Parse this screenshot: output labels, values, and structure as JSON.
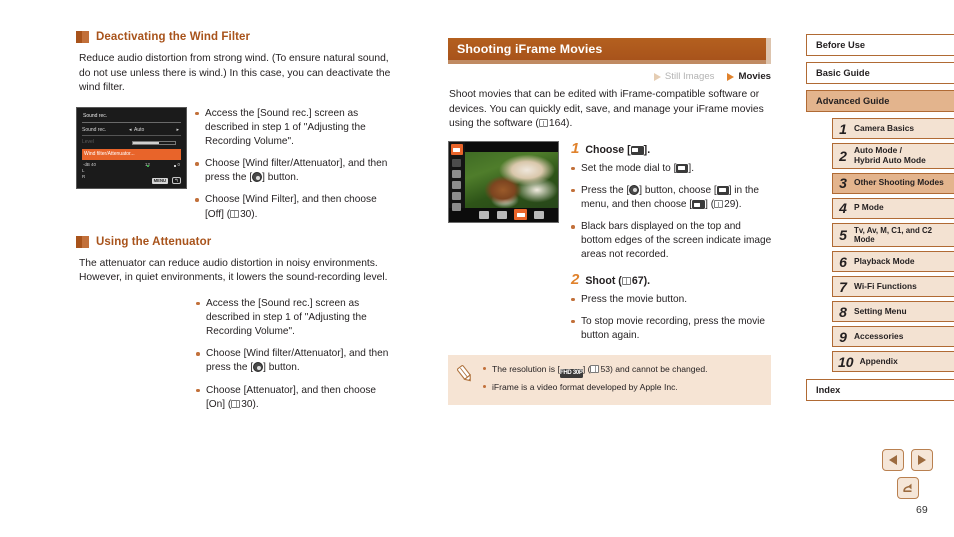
{
  "left_column": {
    "sections": [
      {
        "heading": "Deactivating the Wind Filter",
        "intro": "Reduce audio distortion from strong wind. (To ensure natural sound, do not use unless there is wind.) In this case, you can deactivate the wind filter.",
        "screen": {
          "title": "Sound rec.",
          "row1_label": "Sound rec.",
          "row1_value": "Auto",
          "row2_label": "Level",
          "selected_row": "Wind filter/Attenuator...",
          "scale_left": "-dB 40",
          "scale_mid": "12",
          "scale_right": "0",
          "channel_l": "L",
          "channel_r": "R",
          "menu_button": "MENU"
        },
        "bullets": [
          "Access the [Sound rec.] screen as described in step 1 of \"Adjusting the Recording Volume\".",
          "Choose [Wind filter/Attenuator], and then press the [FUNC] button.",
          "Choose [Wind Filter], and then choose [Off] (30)."
        ],
        "bullet3_parts": {
          "pre": "Choose [Wind Filter], and then choose [Off] (",
          "page_ref": "30",
          "post": ")."
        }
      },
      {
        "heading": "Using the Attenuator",
        "intro": "The attenuator can reduce audio distortion in noisy environments. However, in quiet environments, it lowers the sound-recording level.",
        "bullets": [
          "Access the [Sound rec.] screen as described in step 1 of \"Adjusting the Recording Volume\".",
          "Choose [Wind filter/Attenuator], and then press the [FUNC] button.",
          "Choose [Attenuator], and then choose [On] (30)."
        ],
        "bullet3_parts": {
          "pre": "Choose [Attenuator], and then choose [On] (",
          "page_ref": "30",
          "post": ")."
        }
      }
    ]
  },
  "middle_column": {
    "header_title": "Shooting iFrame Movies",
    "media_tags": [
      {
        "label": "Still Images",
        "active": false
      },
      {
        "label": "Movies",
        "active": true
      }
    ],
    "intro_pre": "Shoot movies that can be edited with iFrame-compatible software or devices. You can quickly edit, save, and manage your iFrame movies using the software (",
    "intro_ref": "164",
    "intro_post": ").",
    "steps": [
      {
        "number": "1",
        "label_pre": "Choose [",
        "label_post": "].",
        "bullets": [
          {
            "pre": "Set the mode dial to [",
            "mid": "",
            "post": "]."
          },
          {
            "pre": "Press the [",
            "mid": "] button, choose [",
            "post": "] in the menu, and then choose [",
            "ref": "29",
            "tail": ")."
          },
          {
            "plain": "Black bars displayed on the top and bottom edges of the screen indicate image areas not recorded."
          }
        ]
      },
      {
        "number": "2",
        "label_pre": "Shoot (",
        "label_ref": "67",
        "label_post": ").",
        "bullets": [
          {
            "plain": "Press the movie button."
          },
          {
            "plain": "To stop movie recording, press the movie button again."
          }
        ]
      }
    ],
    "note": {
      "items": [
        {
          "pre": "The resolution is [",
          "badge": "FHD 30P",
          "mid": "] (",
          "ref": "53",
          "post": ") and cannot be changed."
        },
        {
          "plain": "iFrame is a video format developed by Apple Inc."
        }
      ]
    }
  },
  "sidebar": {
    "top_items": [
      {
        "label": "Before Use",
        "active": false
      },
      {
        "label": "Basic Guide",
        "active": false
      },
      {
        "label": "Advanced Guide",
        "active": true
      }
    ],
    "chapters": [
      {
        "num": "1",
        "name": "Camera Basics",
        "active": false
      },
      {
        "num": "2",
        "name": "Auto Mode /\nHybrid Auto Mode",
        "active": false
      },
      {
        "num": "3",
        "name": "Other Shooting Modes",
        "active": true
      },
      {
        "num": "4",
        "name": "P Mode",
        "active": false
      },
      {
        "num": "5",
        "name": "Tv, Av, M, C1, and C2 Mode",
        "active": false
      },
      {
        "num": "6",
        "name": "Playback Mode",
        "active": false
      },
      {
        "num": "7",
        "name": "Wi-Fi Functions",
        "active": false
      },
      {
        "num": "8",
        "name": "Setting Menu",
        "active": false
      },
      {
        "num": "9",
        "name": "Accessories",
        "active": false
      },
      {
        "num": "10",
        "name": "Appendix",
        "active": false
      }
    ],
    "index_label": "Index"
  },
  "footer": {
    "prev_icon": "left-arrow-icon",
    "next_icon": "right-arrow-icon",
    "back_icon": "return-arrow-icon",
    "page_number": "69"
  },
  "colors": {
    "brand_orange": "#a8531b",
    "accent_orange": "#e0822c",
    "note_bg": "#f6e4d4",
    "sidebar_active": "#e3b48d",
    "sidebar_fill": "#f3e2d2",
    "lcd_select": "#e8642a"
  }
}
